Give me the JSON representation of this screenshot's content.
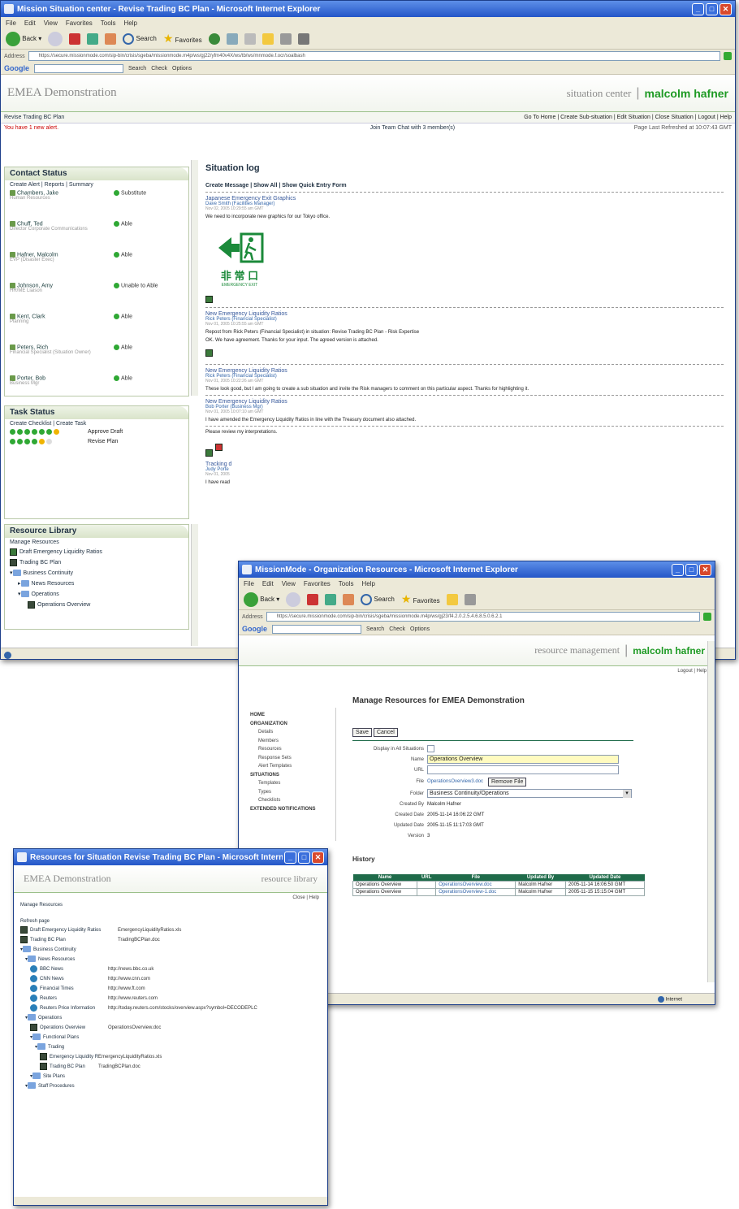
{
  "main_window": {
    "title": "Mission Situation center - Revise Trading BC Plan - Microsoft Internet Explorer",
    "menu": [
      "File",
      "Edit",
      "View",
      "Favorites",
      "Tools",
      "Help"
    ],
    "toolbar": {
      "back": "Back",
      "search": "Search",
      "favorites": "Favorites"
    },
    "address_label": "Address",
    "address_url": "https://secure.missionmode.com/sip-bin/crisis/sgeba/missionmode.m4p/ws/gj22/yfm40v4X/ws/tb/ws/mnmode.f.ocr/soalbash",
    "google": {
      "logo": "Google",
      "search": "Search",
      "check": "Check",
      "options": "Options"
    },
    "header": {
      "org": "EMEA Demonstration",
      "section": "situation center",
      "user": "malcolm hafner"
    },
    "breadcrumb": "Revise Trading BC Plan",
    "top_links": [
      "Go To Home",
      "Create Sub-situation",
      "Edit Situation",
      "Close Situation",
      "Logout",
      "Help"
    ],
    "alert": "You have 1 new alert.",
    "team_chat": "Join Team Chat with 3 member(s)",
    "refreshed": "Page Last Refreshed at 10:07:43 GMT",
    "contact": {
      "title": "Contact Status",
      "links": "Create Alert | Reports | Summary",
      "items": [
        {
          "name": "Chambers, Jake",
          "role": "Human Resources",
          "status": "Substitute"
        },
        {
          "name": "Chuff, Ted",
          "role": "Director Corporate Communications",
          "status": "Able"
        },
        {
          "name": "Hafner, Malcolm",
          "role": "EVP (Disaster Exec)",
          "status": "Able"
        },
        {
          "name": "Johnson, Amy",
          "role": "HR/ME Liaison",
          "status": "Unable to Able"
        },
        {
          "name": "Kent, Clark",
          "role": "Planning",
          "status": "Able"
        },
        {
          "name": "Peters, Rich",
          "role": "Financial Specialist (Situation Owner)",
          "status": "Able"
        },
        {
          "name": "Porter, Bob",
          "role": "Business Mgr",
          "status": "Able"
        }
      ]
    },
    "task": {
      "title": "Task Status",
      "links": "Create Checklist | Create Task",
      "items": [
        {
          "label": "Approve Draft"
        },
        {
          "label": "Revise Plan"
        }
      ]
    },
    "resource": {
      "title": "Resource Library",
      "manage": "Manage Resources",
      "items": [
        "Draft Emergency Liquidity Ratios",
        "Trading BC Plan",
        "Business Continuity",
        "News Resources",
        "Operations",
        "Operations Overview"
      ]
    },
    "log": {
      "title": "Situation log",
      "links": "Create Message | Show All | Show Quick Entry Form",
      "sign_jp": "非 常 口",
      "sign_en": "EMERGENCY EXIT",
      "entries": [
        {
          "title": "Japanese Emergency Exit Graphics",
          "author": "Dave Smith (Facilities Manager)",
          "date": "Nov 02, 2005 10:29:55 am GMT",
          "body": "We need to incorporate new graphics for our Tokyo office."
        },
        {
          "title": "New Emergency Liquidity Ratios",
          "author": "Rick Peters (Financial Specialist)",
          "date": "Nov 01, 2005 10:25:55 am GMT",
          "body": "Repost from Rick Peters (Financial Specialist) in situation: Revise Trading BC Plan - Risk Expertise",
          "body2": "OK. We have agreement. Thanks for your input. The agreed version is attached."
        },
        {
          "title": "New Emergency Liquidity Ratios",
          "author": "Rick Peters (Financial Specialist)",
          "date": "Nov 01, 2005 10:22:26 am GMT",
          "body": "These look good, but I am going to create a sub situation and invite the Risk managers to comment on this particular aspect. Thanks for highlighting it."
        },
        {
          "title": "New Emergency Liquidity Ratios",
          "author": "Bob Porter (Business Mgr)",
          "date": "Nov 01, 2005 10:07:10 am GMT",
          "body": "I have amended the Emergency Liquidity Ratios in line with the Treasury document also attached."
        },
        {
          "title": "",
          "author": "",
          "date": "",
          "body": "Please review my interpretations."
        },
        {
          "title": "Tracking d",
          "author": "Judy Porte",
          "date": "Nov 01, 2005",
          "body": "I have read"
        }
      ]
    }
  },
  "org_window": {
    "title": "MissionMode - Organization Resources - Microsoft Internet Explorer",
    "address_url": "https://secure.missionmode.com/sip-bin/crisis/sgeba/missionmode.m4p/ws/gj23/f4.2.0.2.5.4.6.8.5.0.6.2.1",
    "header": {
      "section": "resource management",
      "user": "malcolm hafner"
    },
    "top_links": "Logout | Help",
    "nav": {
      "home": "HOME",
      "org": "ORGANIZATION",
      "org_items": [
        "Details",
        "Members",
        "Resources",
        "Response Sets",
        "Alert Templates"
      ],
      "sit": "SITUATIONS",
      "sit_items": [
        "Templates",
        "Types",
        "Checklists"
      ],
      "ext": "EXTENDED NOTIFICATIONS"
    },
    "page_title": "Manage Resources for EMEA Demonstration",
    "save": "Save",
    "cancel": "Cancel",
    "fields": {
      "display_label": "Display in All Situations",
      "name_label": "Name",
      "name_value": "Operations Overview",
      "url_label": "URL",
      "url_value": "",
      "file_label": "File",
      "file_value": "OperationsOverview3.doc",
      "remove": "Remove File",
      "folder_label": "Folder",
      "folder_value": "Business Continuity/Operations",
      "created_by_label": "Created By",
      "created_by": "Malcolm Hafner",
      "created_label": "Created Date",
      "created": "2005-11-14 16:06:22 GMT",
      "updated_label": "Updated Date",
      "updated": "2005-11-15 11:17:03 GMT",
      "version_label": "Version",
      "version": "3"
    },
    "history_title": "History",
    "history_headers": [
      "Name",
      "URL",
      "File",
      "Updated By",
      "Updated Date"
    ],
    "history_rows": [
      [
        "Operations Overview",
        "",
        "OperationsOverview.doc",
        "Malcolm Hafner",
        "2005-11-14 16:06:50 GMT"
      ],
      [
        "Operations Overview",
        "",
        "OperationsOverview-1.doc",
        "Malcolm Hafner",
        "2005-11-15 15:15:04 GMT"
      ]
    ],
    "status_zone": "Internet"
  },
  "lib_window": {
    "title": "Resources for Situation Revise Trading BC Plan - Microsoft Internet Expl...",
    "header": {
      "org": "EMEA Demonstration",
      "section": "resource library"
    },
    "close_help": "Close | Help",
    "manage": "Manage Resources",
    "refresh": "Refresh page",
    "tree": [
      {
        "name": "Draft Emergency Liquidity Ratios",
        "value": "EmergencyLiquidityRatios.xls",
        "icon": "doc",
        "depth": 0
      },
      {
        "name": "Trading BC Plan",
        "value": "TradingBCPlan.doc",
        "icon": "doc",
        "depth": 0
      },
      {
        "name": "Business Continuity",
        "value": "",
        "icon": "folder",
        "depth": 0
      },
      {
        "name": "News Resources",
        "value": "",
        "icon": "folder",
        "depth": 1
      },
      {
        "name": "BBC News",
        "value": "http://news.bbc.co.uk",
        "icon": "globe",
        "depth": 2
      },
      {
        "name": "CNN News",
        "value": "http://www.cnn.com",
        "icon": "globe",
        "depth": 2
      },
      {
        "name": "Financial Times",
        "value": "http://www.ft.com",
        "icon": "globe",
        "depth": 2
      },
      {
        "name": "Reuters",
        "value": "http://www.reuters.com",
        "icon": "globe",
        "depth": 2
      },
      {
        "name": "Reuters Price Information",
        "value": "http://today.reuters.com/stocks/overview.aspx?symbol=DECODEPLC",
        "icon": "globe",
        "depth": 2
      },
      {
        "name": "Operations",
        "value": "",
        "icon": "folder",
        "depth": 1
      },
      {
        "name": "Operations Overview",
        "value": "OperationsOverview.doc",
        "icon": "doc",
        "depth": 2
      },
      {
        "name": "Functional Plans",
        "value": "",
        "icon": "folder",
        "depth": 2
      },
      {
        "name": "Trading",
        "value": "",
        "icon": "folder",
        "depth": 3
      },
      {
        "name": "Emergency Liquidity Ratios",
        "value": "EmergencyLiquidityRatios.xls",
        "icon": "doc",
        "depth": 4
      },
      {
        "name": "Trading BC Plan",
        "value": "TradingBCPlan.doc",
        "icon": "doc",
        "depth": 4
      },
      {
        "name": "Site Plans",
        "value": "",
        "icon": "folder",
        "depth": 2
      },
      {
        "name": "Staff Procedures",
        "value": "",
        "icon": "folder",
        "depth": 1
      }
    ]
  },
  "colors": {
    "accent_green": "#1e9a24",
    "titlebar": "#2456c8",
    "history_header": "#1f6b4a",
    "highlight_field": "#fffbc0"
  }
}
